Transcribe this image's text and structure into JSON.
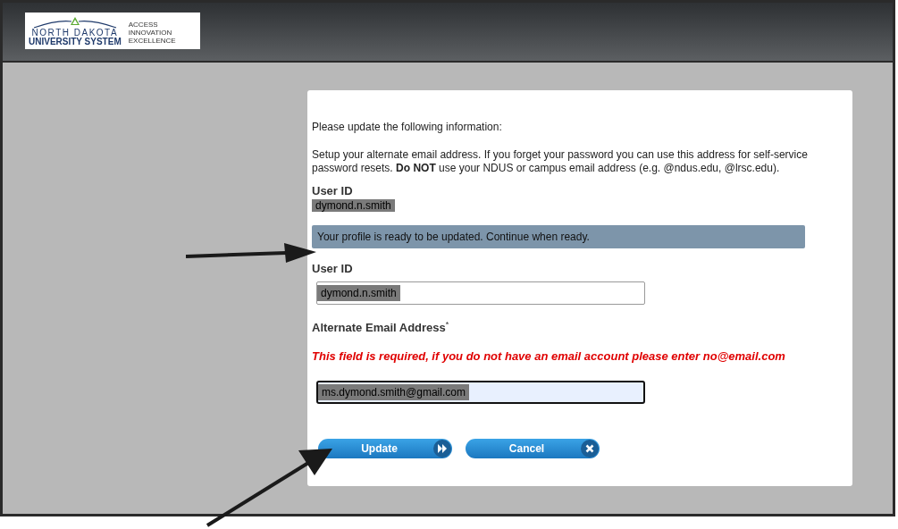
{
  "header": {
    "logo": {
      "line1": "NORTH DAKOTA",
      "line2": "UNIVERSITY SYSTEM",
      "tagline": [
        "ACCESS",
        "INNOVATION",
        "EXCELLENCE"
      ]
    }
  },
  "form": {
    "intro": "Please update the following information:",
    "description": "Setup your alternate email address. If you forget your password you can use this address for self-service password resets. **Do NOT** use your NDUS or campus email address (e.g. @ndus.edu, @lrsc.edu).",
    "current_user": {
      "label": "User ID",
      "value": "dymond.n.smith"
    },
    "notice": "Your profile is ready to be updated. Continue when ready.",
    "user_id_field": {
      "label": "User ID",
      "value": "dymond.n.smith"
    },
    "email_field": {
      "label": "Alternate Email Address",
      "required_mark": "*",
      "error": "This field is required, if you do not have an email account please enter no@email.com",
      "value": "ms.dymond.smith@gmail.com",
      "focused": true
    },
    "buttons": [
      {
        "label": "Update",
        "kind": "next"
      },
      {
        "label": "Cancel",
        "kind": "close"
      }
    ]
  }
}
